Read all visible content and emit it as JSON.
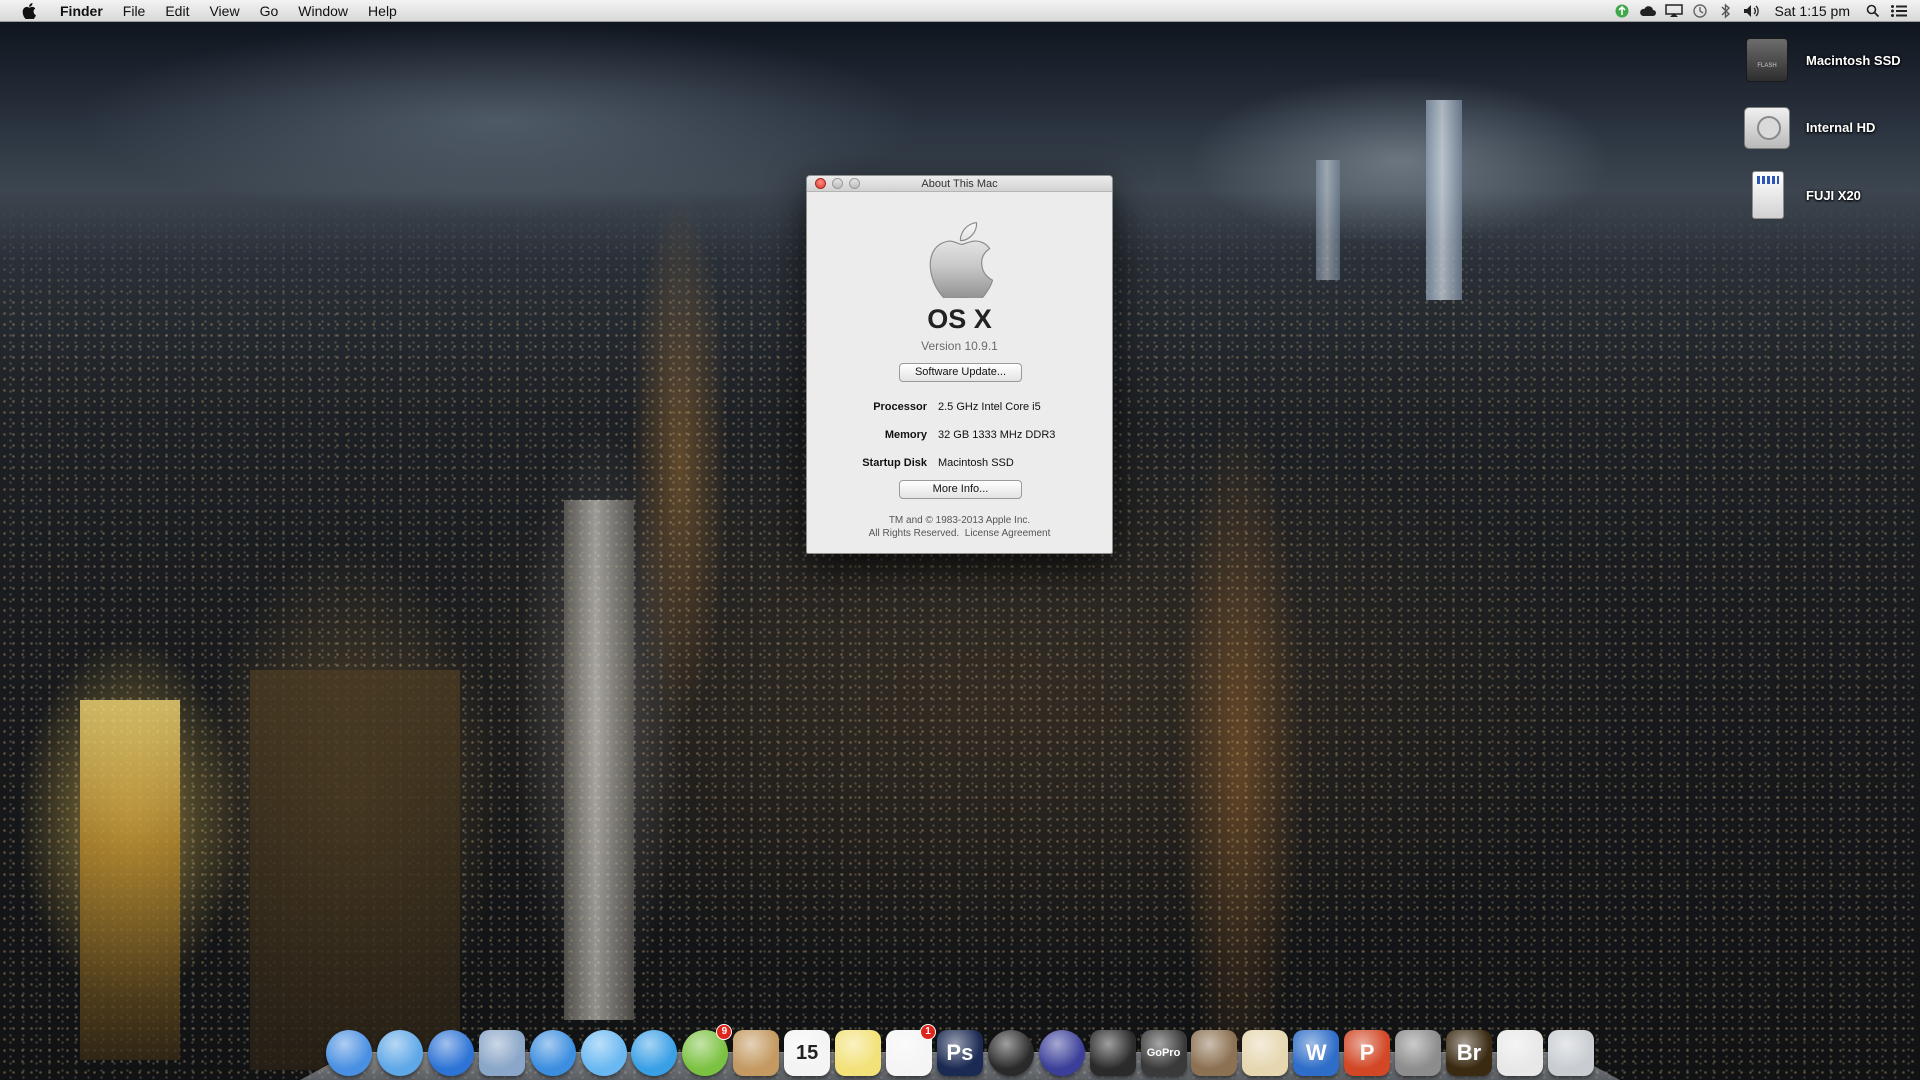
{
  "menubar": {
    "app_name": "Finder",
    "items": [
      "File",
      "Edit",
      "View",
      "Go",
      "Window",
      "Help"
    ],
    "clock": "Sat 1:15 pm",
    "status_icons": [
      "upload-status-icon",
      "cloud-icon",
      "airplay-icon",
      "time-machine-icon",
      "bluetooth-icon",
      "volume-icon",
      "spotlight-icon",
      "notification-center-icon"
    ]
  },
  "desktop": {
    "icons": [
      {
        "label": "Macintosh SSD",
        "icon": "ssd-drive-icon"
      },
      {
        "label": "Internal HD",
        "icon": "hard-drive-icon"
      },
      {
        "label": "FUJI X20",
        "icon": "sd-card-icon"
      }
    ]
  },
  "about": {
    "window_title": "About This Mac",
    "os_name": "OS X",
    "version": "Version 10.9.1",
    "software_update_label": "Software Update...",
    "specs": [
      {
        "key": "Processor",
        "value": "2.5 GHz Intel Core i5"
      },
      {
        "key": "Memory",
        "value": "32 GB 1333 MHz DDR3"
      },
      {
        "key": "Startup Disk",
        "value": "Macintosh SSD"
      }
    ],
    "more_info_label": "More Info...",
    "legal_line1": "TM and © 1983-2013 Apple Inc.",
    "legal_line2": "All Rights Reserved.",
    "license_link": "License Agreement"
  },
  "dock": {
    "items": [
      {
        "name": "finder-icon",
        "color": "#4a90e2"
      },
      {
        "name": "weather-icon",
        "color": "#5fa8e8"
      },
      {
        "name": "app-store-icon",
        "color": "#2e74d6"
      },
      {
        "name": "mail-stamp-icon",
        "color": "#8aa6c8"
      },
      {
        "name": "safari-icon",
        "color": "#3c8ee0"
      },
      {
        "name": "messages-icon",
        "color": "#6ab8f2"
      },
      {
        "name": "itunes-icon",
        "color": "#3aa0e6"
      },
      {
        "name": "spotify-icon",
        "color": "#7cc242",
        "badge": "9"
      },
      {
        "name": "contacts-icon",
        "color": "#c49a62"
      },
      {
        "name": "calendar-icon",
        "color": "#f4f4f4",
        "text": "15"
      },
      {
        "name": "stickies-icon",
        "color": "#f3e27a"
      },
      {
        "name": "reminders-icon",
        "color": "#f5f5f5",
        "badge": "1"
      },
      {
        "name": "photoshop-icon",
        "color": "#1b2a52",
        "text": "Ps"
      },
      {
        "name": "aperture-icon",
        "color": "#2a2a2a"
      },
      {
        "name": "imovie-icon",
        "color": "#3b3f99"
      },
      {
        "name": "final-cut-icon",
        "color": "#2b2b2b"
      },
      {
        "name": "gopro-icon",
        "color": "#3a3a3a",
        "text": "GoPro"
      },
      {
        "name": "lightroom-book-icon",
        "color": "#8c7152"
      },
      {
        "name": "pages-icon",
        "color": "#e6d7b0"
      },
      {
        "name": "word-icon",
        "color": "#2f6ec8",
        "text": "W"
      },
      {
        "name": "powerpoint-icon",
        "color": "#d24726",
        "text": "P"
      },
      {
        "name": "system-preferences-icon",
        "color": "#8d8d8d"
      },
      {
        "name": "bridge-icon",
        "color": "#3a2a12",
        "text": "Br"
      },
      {
        "name": "downloads-stack-icon",
        "color": "#e8e8e8"
      },
      {
        "name": "trash-icon",
        "color": "#c9cdd2"
      }
    ]
  },
  "colors": {
    "close_button": "#d8392f",
    "menubar_top": "#f3f3f3",
    "window_bg": "#ececec"
  }
}
